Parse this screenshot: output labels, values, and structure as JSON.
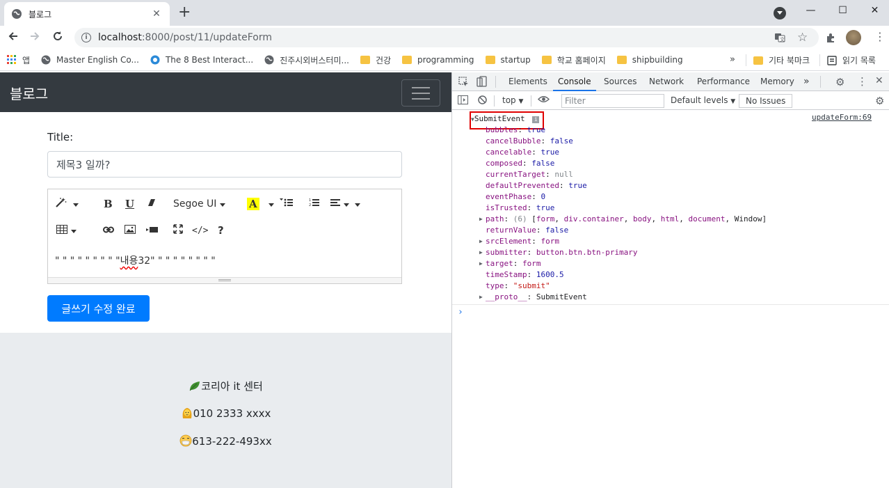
{
  "browser": {
    "tab_title": "블로그",
    "tab_close": "✕",
    "new_tab": "+",
    "url_host": "localhost",
    "url_path": ":8000/post/11/updateForm",
    "window_controls": [
      "—",
      "☐",
      "✕"
    ]
  },
  "bookmarks": [
    {
      "label": "앱",
      "icon": "apps-grid-icon"
    },
    {
      "label": "Master English Co...",
      "icon": "globe-icon"
    },
    {
      "label": "The 8 Best Interact...",
      "icon": "globe-icon"
    },
    {
      "label": "진주시외버스터미...",
      "icon": "globe-icon"
    },
    {
      "label": "건강",
      "icon": "folder-icon"
    },
    {
      "label": "programming",
      "icon": "folder-icon"
    },
    {
      "label": "startup",
      "icon": "folder-icon"
    },
    {
      "label": "학교 홈페이지",
      "icon": "folder-icon"
    },
    {
      "label": "shipbuilding",
      "icon": "folder-icon"
    }
  ],
  "bookmarks_more": "»",
  "bookmarks_other": "기타 북마크",
  "reading_list": "읽기 목록",
  "page": {
    "brand": "블로그",
    "title_label": "Title:",
    "title_value": "제목3 일까?",
    "font_name": "Segoe UI",
    "editor_content_prefix": "\" \" \" \" \" \" \" \" \"",
    "editor_content_word": "내용",
    "editor_content_suffix": "32\" \" \" \" \" \" \" \" \"",
    "submit_label": "글쓰기 수정 완료",
    "footer": [
      {
        "emoji": "🌿",
        "text": "코리아 it 센터"
      },
      {
        "emoji": "😷",
        "text": "010 2333 xxxx"
      },
      {
        "emoji": "😷",
        "text": "613-222-493xx"
      }
    ]
  },
  "devtools": {
    "tabs": [
      "Elements",
      "Console",
      "Sources",
      "Network",
      "Performance",
      "Memory"
    ],
    "active_tab": "Console",
    "context": "top",
    "filter_placeholder": "Filter",
    "levels": "Default levels",
    "issues": "No Issues",
    "source_link": "updateForm:69",
    "event_name": "SubmitEvent",
    "props": [
      {
        "key": "bubbles",
        "value": "true",
        "type": "bool"
      },
      {
        "key": "cancelBubble",
        "value": "false",
        "type": "bool"
      },
      {
        "key": "cancelable",
        "value": "true",
        "type": "bool"
      },
      {
        "key": "composed",
        "value": "false",
        "type": "bool"
      },
      {
        "key": "currentTarget",
        "value": "null",
        "type": "null"
      },
      {
        "key": "defaultPrevented",
        "value": "true",
        "type": "bool"
      },
      {
        "key": "eventPhase",
        "value": "0",
        "type": "bool"
      },
      {
        "key": "isTrusted",
        "value": "true",
        "type": "bool"
      },
      {
        "key": "path",
        "value": "(6) [form, div.container, body, html, document, Window]",
        "type": "obj",
        "expand": true
      },
      {
        "key": "returnValue",
        "value": "false",
        "type": "bool"
      },
      {
        "key": "srcElement",
        "value": "form",
        "type": "obj",
        "expand": true
      },
      {
        "key": "submitter",
        "value": "button.btn.btn-primary",
        "type": "obj",
        "expand": true
      },
      {
        "key": "target",
        "value": "form",
        "type": "obj",
        "expand": true
      },
      {
        "key": "timeStamp",
        "value": "1600.5",
        "type": "bool"
      },
      {
        "key": "type",
        "value": "\"submit\"",
        "type": "str"
      },
      {
        "key": "__proto__",
        "value": "SubmitEvent",
        "type": "plain",
        "expand": true
      }
    ]
  }
}
